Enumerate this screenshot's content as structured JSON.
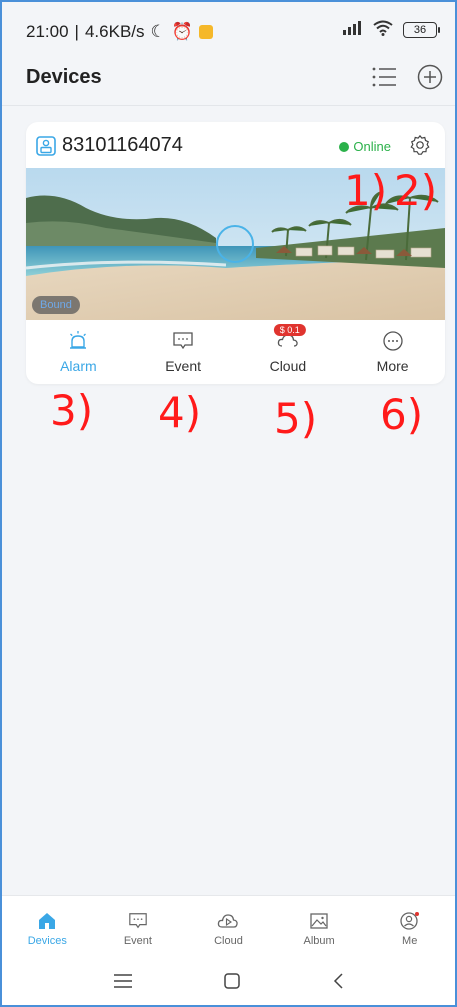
{
  "status_bar": {
    "time": "21:00",
    "speed": "4.6KB/s",
    "battery": "36"
  },
  "header": {
    "title": "Devices"
  },
  "device_card": {
    "device_id": "83101164074",
    "status": "Online",
    "bound_label": "Bound",
    "actions": [
      {
        "label": "Alarm"
      },
      {
        "label": "Event"
      },
      {
        "label": "Cloud",
        "badge": "$ 0.1"
      },
      {
        "label": "More"
      }
    ]
  },
  "annotations": [
    "1)",
    "2)",
    "3)",
    "4)",
    "5)",
    "6)"
  ],
  "bottom_nav": {
    "items": [
      {
        "label": "Devices"
      },
      {
        "label": "Event"
      },
      {
        "label": "Cloud"
      },
      {
        "label": "Album"
      },
      {
        "label": "Me"
      }
    ]
  },
  "colors": {
    "accent": "#3aa7e6",
    "online": "#2bb14a",
    "annotation": "#ff1a1a",
    "badge": "#e0342f"
  },
  "icons": {
    "list": "list-icon",
    "add": "add-circle-icon",
    "settings": "gear-icon",
    "play": "play-ring-icon"
  }
}
